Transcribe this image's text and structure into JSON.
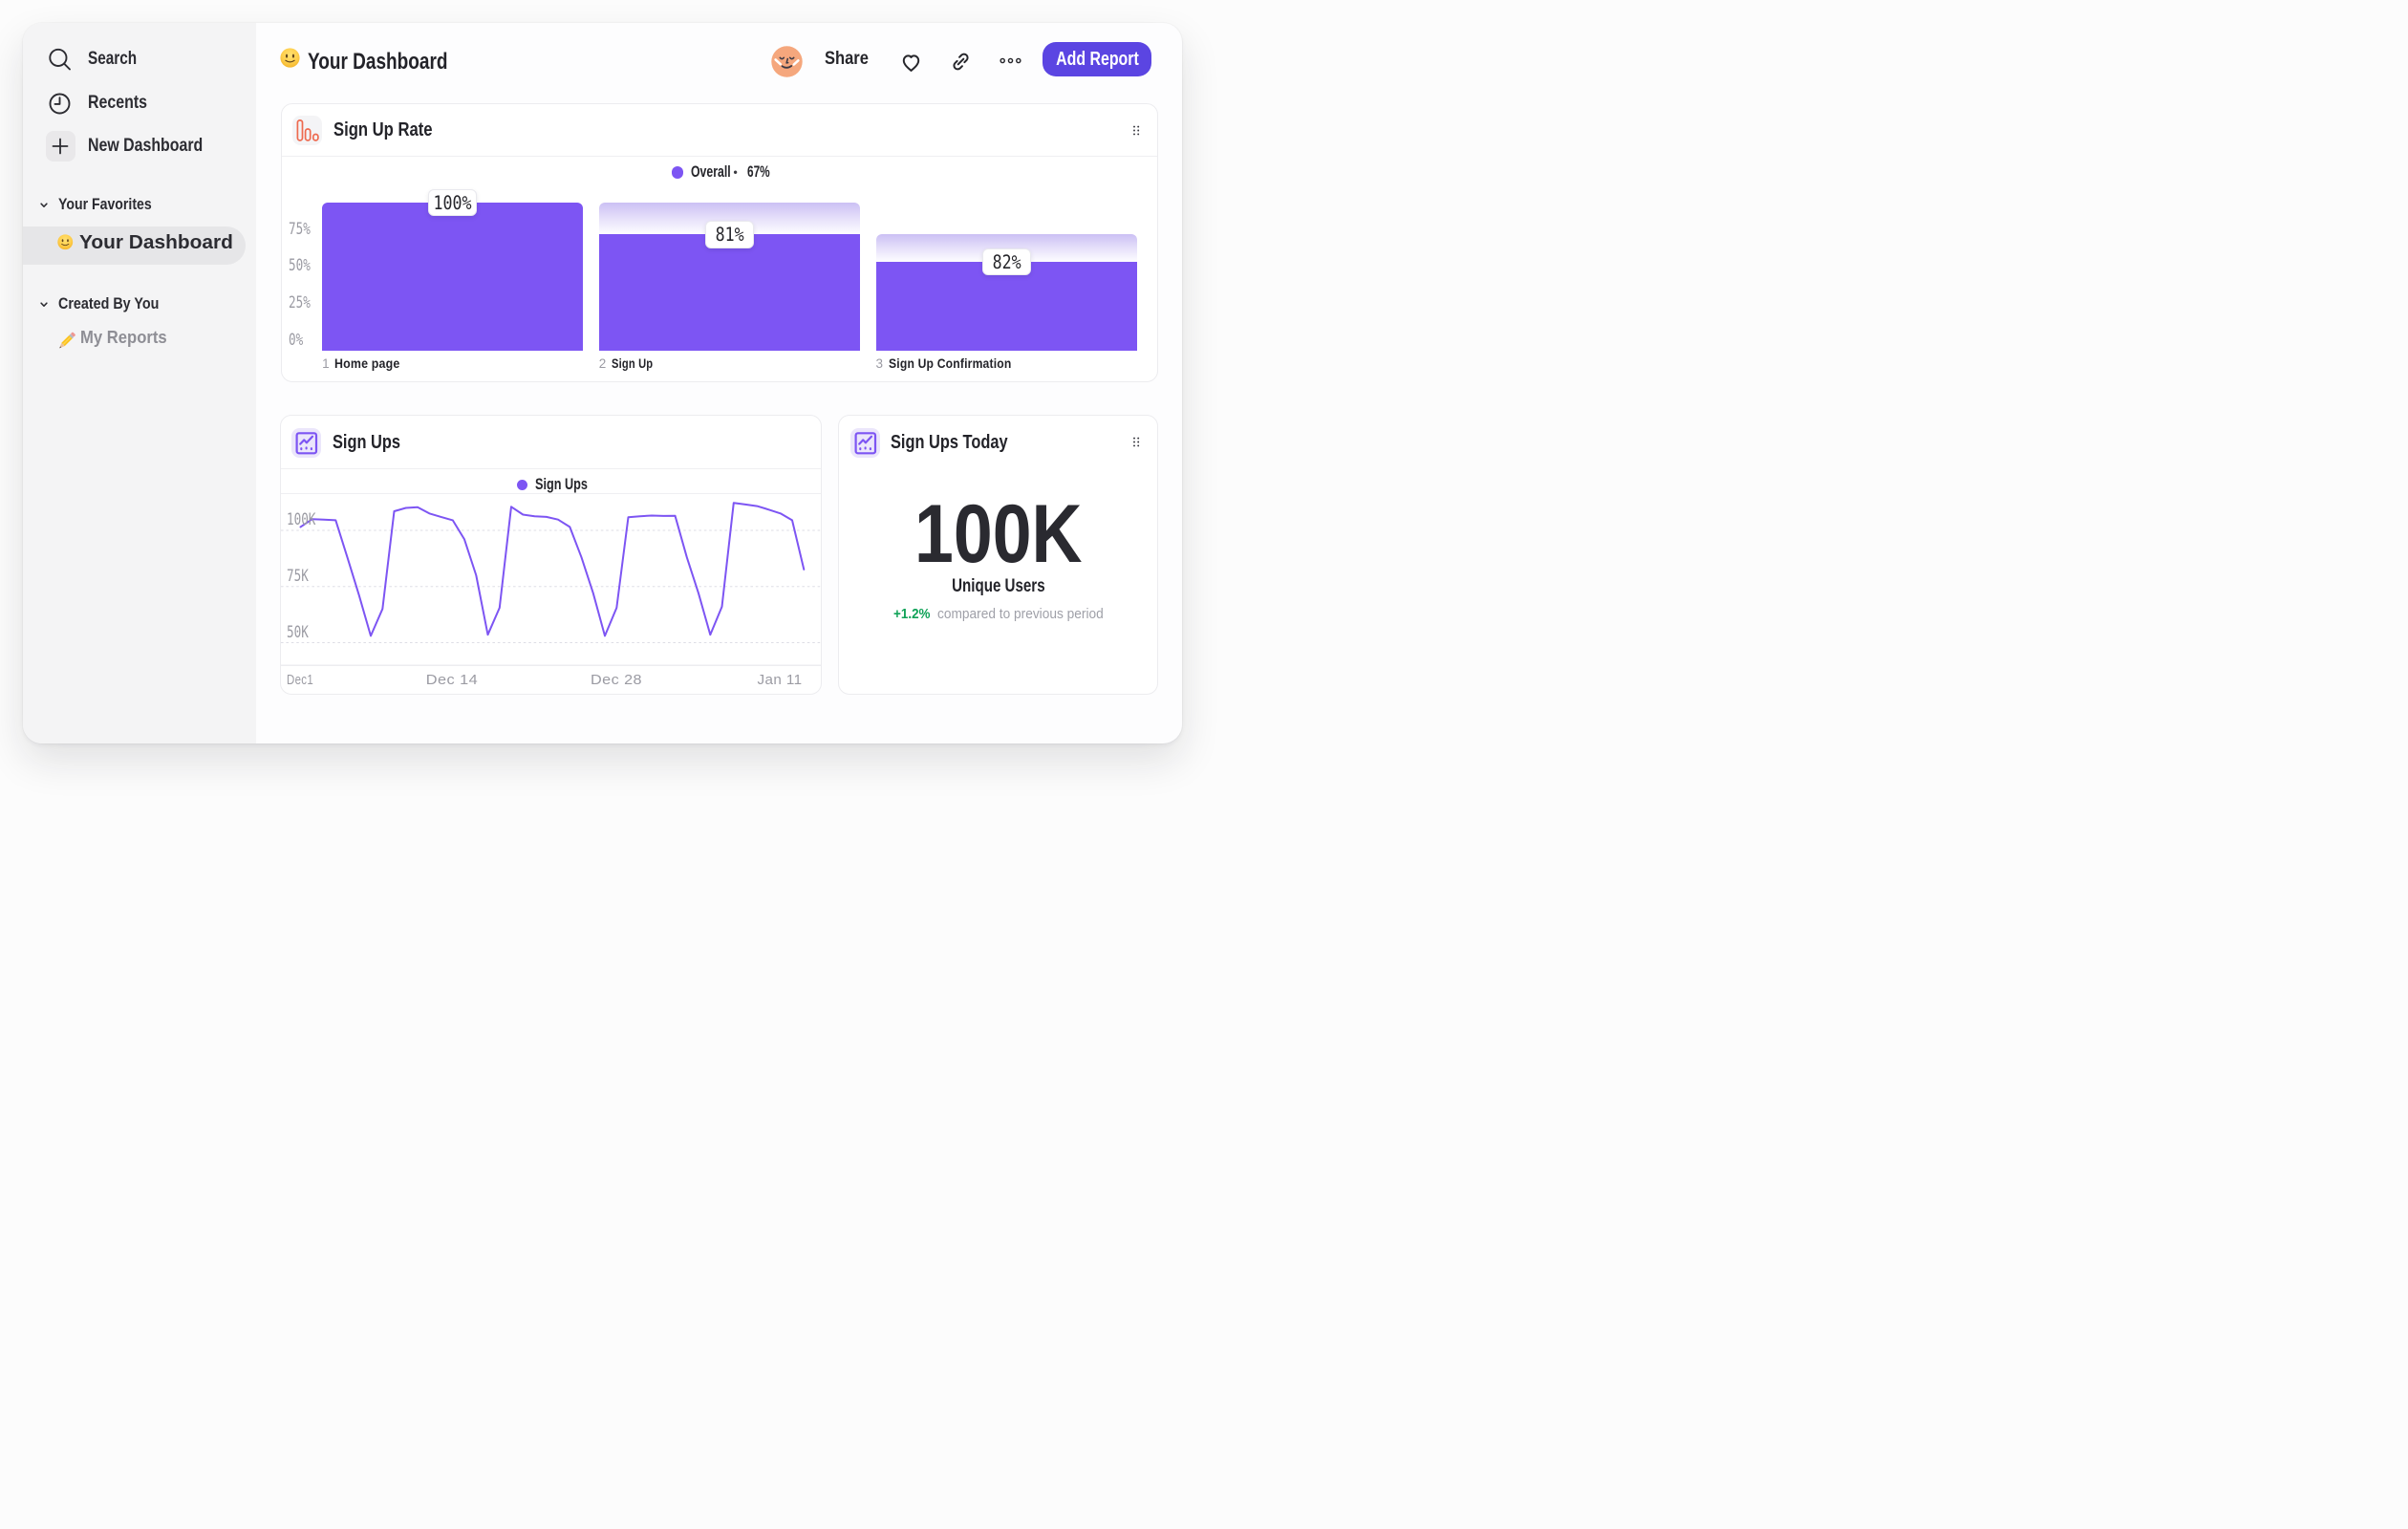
{
  "header": {
    "title": "Your Dashboard",
    "title_emoji": "slightly-smiling-face",
    "share_label": "Share",
    "add_report_label": "Add Report"
  },
  "sidebar": {
    "search_label": "Search",
    "recents_label": "Recents",
    "new_dashboard_label": "New Dashboard",
    "favorites_section_label": "Your Favorites",
    "favorites_item_label": "Your Dashboard",
    "favorites_item_emoji": "slightly-smiling-face",
    "created_section_label": "Created By You",
    "created_item_label": "My Reports",
    "created_item_emoji": "pencil"
  },
  "cards": {
    "funnel": {
      "title": "Sign Up Rate",
      "legend_label": "Overall",
      "legend_sep": "•",
      "legend_value": "67%"
    },
    "line": {
      "title": "Sign Ups",
      "legend_label": "Sign Ups"
    },
    "stat": {
      "title": "Sign Ups Today",
      "value": "100K",
      "caption": "Unique Users",
      "delta": "+1.2%",
      "delta_caption": "compared to previous period"
    }
  },
  "colors": {
    "accent_purple": "#7d55f3",
    "button_purple": "#5b45e2",
    "icon_orange": "#ee6a4f",
    "delta_green": "#0fa257"
  },
  "chart_data": [
    {
      "type": "bar",
      "subtype": "funnel",
      "title": "Sign Up Rate",
      "legend": {
        "label": "Overall",
        "value_pct": 67
      },
      "categories": [
        "Home page",
        "Sign Up",
        "Sign Up Confirmation"
      ],
      "step_numbers": [
        "1",
        "2",
        "3"
      ],
      "value_labels": [
        "100%",
        "81%",
        "82%"
      ],
      "conversion_from_previous_pct": [
        100,
        81,
        82
      ],
      "bar_height_pct": [
        100,
        78.5,
        59.9
      ],
      "ghost_top_pct": [
        null,
        100,
        78.5
      ],
      "label_widths": [
        68.45,
        43.3,
        128.5
      ],
      "tooltip_widths": [
        40,
        30,
        30
      ],
      "yticks": [
        {
          "label": "75%",
          "value": 75,
          "tw": 22.8
        },
        {
          "label": "50%",
          "value": 50,
          "tw": 22.8
        },
        {
          "label": "25%",
          "value": 25,
          "tw": 22.8
        },
        {
          "label": "0%",
          "value": 0,
          "tw": 15.2
        }
      ],
      "ylim": [
        0,
        100
      ],
      "bar_color": "#7d55f3",
      "legend_position": "top-center"
    },
    {
      "type": "line",
      "title": "Sign Ups",
      "series": [
        {
          "name": "Sign Ups",
          "values_thousands": [
            101.5,
            105,
            104.8,
            104.5,
            88,
            71,
            53,
            65,
            108.5,
            110,
            110.3,
            107.5,
            106,
            104.5,
            96,
            80,
            53.5,
            65.5,
            110.5,
            107,
            106.3,
            106,
            104.8,
            101.5,
            88,
            72,
            53,
            65.5,
            105.8,
            106.3,
            106.6,
            106.4,
            106.5,
            88,
            72,
            53.5,
            66,
            112.2,
            111.5,
            110.8,
            109.2,
            107.5,
            104.5,
            82.6
          ]
        }
      ],
      "x_tick_labels": [
        "Dec1",
        "Dec 14",
        "Dec 28",
        "Jan 11"
      ],
      "x_tick_day_index": [
        0,
        13,
        27,
        41
      ],
      "x_tick_widths": [
        28,
        54.4,
        54,
        47
      ],
      "yticks": [
        {
          "label": "100K",
          "value": 100,
          "tw": 30.4
        },
        {
          "label": "75K",
          "value": 75,
          "tw": 22.8
        },
        {
          "label": "50K",
          "value": 50,
          "tw": 22.8
        }
      ],
      "y_axis_min_thousands": 39.9,
      "grid": "dashed-horizontal",
      "legend_position": "top-center",
      "line_color": "#7d55f3"
    },
    {
      "type": "stat",
      "title": "Sign Ups Today",
      "value": "100K",
      "label": "Unique Users",
      "delta": "+1.2%",
      "delta_note": "compared to previous period"
    }
  ]
}
